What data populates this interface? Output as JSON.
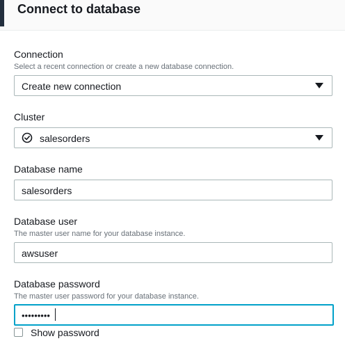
{
  "header": {
    "title": "Connect to database"
  },
  "connection": {
    "label": "Connection",
    "description": "Select a recent connection or create a new database connection.",
    "selected_value": "Create new connection"
  },
  "cluster": {
    "label": "Cluster",
    "selected_value": "salesorders",
    "status_icon": "check-circle-icon"
  },
  "database_name": {
    "label": "Database name",
    "value": "salesorders"
  },
  "database_user": {
    "label": "Database user",
    "description": "The master user name for your database instance.",
    "value": "awsuser"
  },
  "database_password": {
    "label": "Database password",
    "description": "The master user password for your database instance.",
    "masked_value": "•••••••••"
  },
  "show_password": {
    "label": "Show password",
    "checked": false
  },
  "colors": {
    "focus_border": "#00a1c9",
    "text": "#16191f",
    "secondary_text": "#687078",
    "input_border": "#aab7b8",
    "header_bg": "#fafafa",
    "left_bar": "#232f3e"
  }
}
